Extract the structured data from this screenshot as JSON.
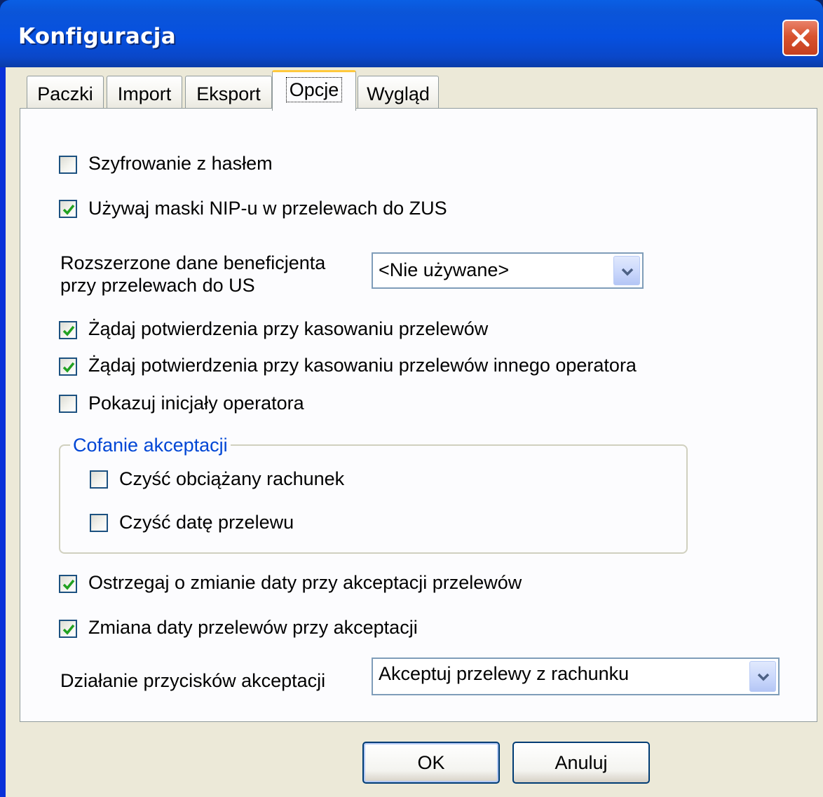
{
  "window": {
    "title": "Konfiguracja",
    "close_icon": "close-icon"
  },
  "tabs": [
    {
      "label": "Paczki",
      "active": false
    },
    {
      "label": "Import",
      "active": false
    },
    {
      "label": "Eksport",
      "active": false
    },
    {
      "label": "Opcje",
      "active": true
    },
    {
      "label": "Wygląd",
      "active": false
    }
  ],
  "options": {
    "encryption": {
      "label": "Szyfrowanie z hasłem",
      "checked": false
    },
    "nip_mask": {
      "label": "Używaj maski NIP-u w przelewach do ZUS",
      "checked": true
    },
    "beneficiary": {
      "label_line1": "Rozszerzone dane beneficjenta",
      "label_line2": "przy przelewach do US",
      "value": "<Nie używane>"
    },
    "confirm_delete": {
      "label": "Żądaj potwierdzenia przy kasowaniu przelewów",
      "checked": true
    },
    "confirm_delete_other": {
      "label": "Żądaj potwierdzenia przy kasowaniu przelewów innego operatora",
      "checked": true
    },
    "show_initials": {
      "label": "Pokazuj inicjały operatora",
      "checked": false
    }
  },
  "group": {
    "title": "Cofanie akceptacji",
    "clear_account": {
      "label": "Czyść obciążany rachunek",
      "checked": false
    },
    "clear_date": {
      "label": "Czyść datę przelewu",
      "checked": false
    }
  },
  "options2": {
    "warn_date": {
      "label": "Ostrzegaj o zmianie daty przy akceptacji przelewów",
      "checked": true
    },
    "change_date": {
      "label": "Zmiana daty przelewów przy akceptacji",
      "checked": true
    },
    "accept_action": {
      "label": "Działanie przycisków akceptacji",
      "value": "Akceptuj przelewy z rachunku"
    }
  },
  "buttons": {
    "ok": "OK",
    "cancel": "Anuluj"
  },
  "colors": {
    "title_bar": "#0650e0",
    "face": "#ece9d8",
    "group_title": "#0046d5",
    "check": "#21a121"
  }
}
